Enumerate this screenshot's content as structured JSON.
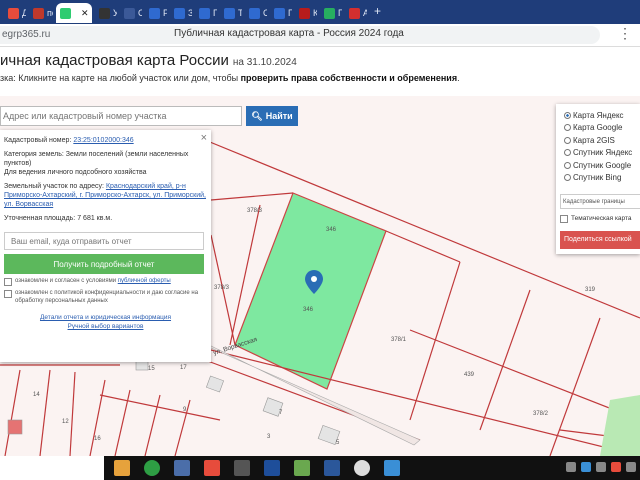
{
  "browser": {
    "tabs": [
      {
        "label": "Д",
        "color": "#e74c3c"
      },
      {
        "label": "пс",
        "color": "#c0392b"
      },
      {
        "label": "",
        "color": "#2ecc71",
        "active": true
      },
      {
        "label": "Ус",
        "color": "#333333"
      },
      {
        "label": "Сп",
        "color": "#3b5998"
      },
      {
        "label": "Ре",
        "color": "#2f6ad0"
      },
      {
        "label": "Зе",
        "color": "#2f6ad0"
      },
      {
        "label": "Пр",
        "color": "#2f6ad0"
      },
      {
        "label": "То",
        "color": "#2f6ad0"
      },
      {
        "label": "Ск",
        "color": "#2f6ad0"
      },
      {
        "label": "По",
        "color": "#2f6ad0"
      },
      {
        "label": "Ка",
        "color": "#b71c1c"
      },
      {
        "label": "П",
        "color": "#27ae60"
      },
      {
        "label": "Ав",
        "color": "#d32f2f"
      }
    ],
    "active_close": "✕",
    "new_tab": "+",
    "address": "egrp365.ru",
    "page_heading": "Публичная кадастровая карта - Россия 2024 года"
  },
  "page": {
    "title": "ичная кадастровая карта России",
    "date": "на 31.10.2024",
    "note_prefix": "зка: Кликните на карте на любой участок или дом, чтобы ",
    "note_bold": "проверить права собственности и обременения",
    "note_suffix": "."
  },
  "search": {
    "placeholder": "Адрес или кадастровый номер участка",
    "button": "Найти"
  },
  "popup": {
    "cadastral_label": "Кадастровый номер:",
    "cadastral_value": "23:25:0102000:346",
    "category_label": "Категория земель:",
    "category_value": "Земли поселений (земли населенных пунктов)",
    "usage": "Для ведения личного подсобного хозяйства",
    "address_label": "Земельный участок по адресу:",
    "address_value": "Краснодарский край, р-н Приморско-Ахтарский, г. Приморско-Ахтарск, ул. Приморский, ул. Ворвасская",
    "area_label": "Уточненная площадь:",
    "area_value": "7 681 кв.м.",
    "email_placeholder": "Ваш email, куда отправить отчет",
    "report_button": "Получить подробный отчет",
    "agree1_prefix": "ознакомлен и согласен с условиями ",
    "agree1_link": "публичной оферты",
    "agree2_prefix": "ознакомлен с политикой конфиденциальности и даю согласие на обработку персональных данных",
    "link1": "Детали отчета и юридическая информация",
    "link2": "Ручной выбор вариантов",
    "close": "×"
  },
  "layers": {
    "options": [
      {
        "label": "Карта Яндекс",
        "checked": true
      },
      {
        "label": "Карта Google",
        "checked": false
      },
      {
        "label": "Карта 2GIS",
        "checked": false
      },
      {
        "label": "Спутник Яндекс",
        "checked": false
      },
      {
        "label": "Спутник Google",
        "checked": false
      },
      {
        "label": "Спутник Bing",
        "checked": false
      }
    ],
    "select_value": "Кадастровые границы",
    "thematic_label": "Тематическая карта",
    "share_button": "Поделиться ссылкой"
  },
  "map_labels": {
    "parcel_378_3a": "378/3",
    "parcel_346_top": "346",
    "parcel_346": "346",
    "parcel_378_3b": "378/3",
    "parcel_378_1": "378/1",
    "parcel_319": "319",
    "parcel_439": "439",
    "parcel_378_2": "378/2",
    "parcel_15": "15",
    "parcel_17": "17",
    "parcel_12": "12",
    "parcel_14": "14",
    "parcel_16": "16",
    "parcel_9": "9",
    "parcel_7": "7",
    "parcel_5": "5",
    "parcel_3": "3",
    "street": "ул. Ворвасская"
  }
}
